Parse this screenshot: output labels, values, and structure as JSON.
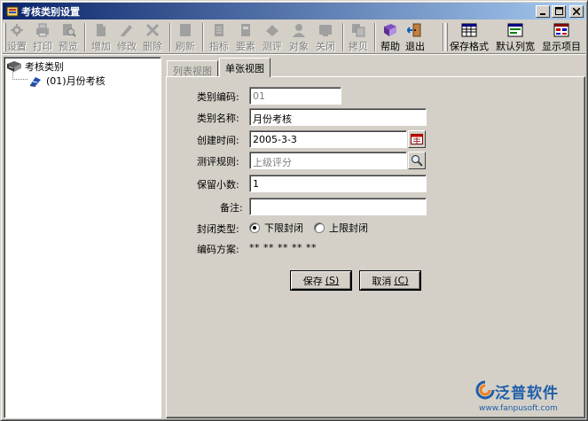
{
  "window": {
    "title": "考核类别设置",
    "controls": {
      "minimize": "_",
      "maximize": "□",
      "close": "×"
    }
  },
  "toolbar": {
    "items": [
      {
        "label": "设置",
        "icon": "settings-icon",
        "enabled": false
      },
      {
        "label": "打印",
        "icon": "print-icon",
        "enabled": false
      },
      {
        "label": "预览",
        "icon": "preview-icon",
        "enabled": false
      },
      {
        "label": "增加",
        "icon": "add-icon",
        "enabled": false
      },
      {
        "label": "修改",
        "icon": "edit-icon",
        "enabled": false
      },
      {
        "label": "删除",
        "icon": "delete-icon",
        "enabled": false
      },
      {
        "label": "刷新",
        "icon": "refresh-icon",
        "enabled": false
      },
      {
        "label": "指标",
        "icon": "indicator-icon",
        "enabled": false
      },
      {
        "label": "要素",
        "icon": "element-icon",
        "enabled": false
      },
      {
        "label": "测评",
        "icon": "evaluate-icon",
        "enabled": false
      },
      {
        "label": "对象",
        "icon": "person-icon",
        "enabled": false
      },
      {
        "label": "关闭",
        "icon": "close-doc-icon",
        "enabled": false
      },
      {
        "label": "拷贝",
        "icon": "copy-icon",
        "enabled": false
      },
      {
        "label": "帮助",
        "icon": "help-book-icon",
        "enabled": true
      },
      {
        "label": "退出",
        "icon": "exit-door-icon",
        "enabled": true
      },
      {
        "label": "保存格式",
        "icon": "save-format-icon",
        "enabled": true
      },
      {
        "label": "默认列宽",
        "icon": "default-width-icon",
        "enabled": true
      },
      {
        "label": "显示项目",
        "icon": "show-items-icon",
        "enabled": true
      }
    ]
  },
  "tree": {
    "root": {
      "label": "考核类别",
      "icon": "books-icon"
    },
    "children": [
      {
        "label": "(01)月份考核",
        "icon": "document-icon"
      }
    ]
  },
  "tabs": [
    {
      "label": "列表视图",
      "active": false
    },
    {
      "label": "单张视图",
      "active": true
    }
  ],
  "form": {
    "code": {
      "label": "类别编码:",
      "value": "01"
    },
    "name": {
      "label": "类别名称:",
      "value": "月份考核"
    },
    "created": {
      "label": "创建时间:",
      "value": "2005-3-3"
    },
    "rule": {
      "label": "测评规则:",
      "value": "上级评分"
    },
    "decimals": {
      "label": "保留小数:",
      "value": "1"
    },
    "remark": {
      "label": "备注:",
      "value": ""
    },
    "close_type": {
      "label": "封闭类型:",
      "options": [
        {
          "label": "下限封闭",
          "checked": true
        },
        {
          "label": "上限封闭",
          "checked": false
        }
      ]
    },
    "coding_scheme": {
      "label": "编码方案:",
      "value": "** ** ** ** **"
    }
  },
  "buttons": {
    "save": {
      "label": "保存",
      "hotkey": "(S)"
    },
    "cancel": {
      "label": "取消",
      "hotkey": "(C)"
    }
  },
  "watermark": {
    "brand": "泛普软件",
    "url": "www.fanpusoft.com"
  },
  "colors": {
    "face": "#d4d0c8",
    "title_start": "#0a246a",
    "title_end": "#a6caf0",
    "brand": "#1f5fa8"
  }
}
